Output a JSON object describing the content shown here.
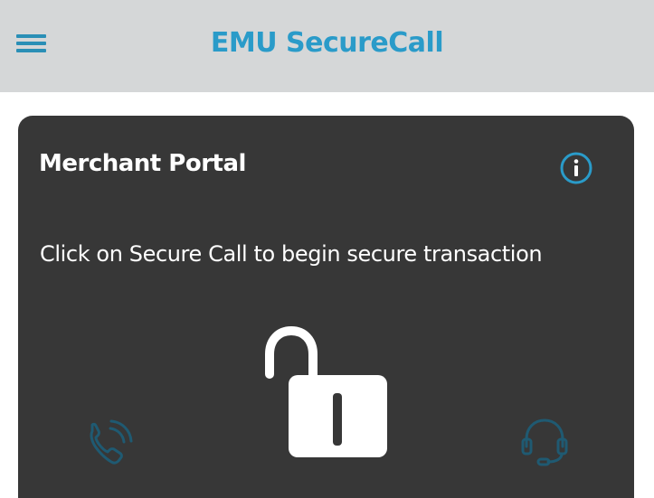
{
  "header": {
    "title": "EMU SecureCall",
    "menu_icon": "hamburger-menu-icon"
  },
  "card": {
    "title": "Merchant Portal",
    "info_icon": "info-icon",
    "instruction": "Click on Secure Call to begin secure transaction",
    "lock_icon": "unlocked-padlock-icon",
    "call_icon": "phone-call-icon",
    "support_icon": "headset-icon"
  },
  "colors": {
    "header_bg": "#d5d7d8",
    "accent": "#2a9bc9",
    "card_bg": "#373737",
    "muted_icon": "#1f5a72",
    "text_light": "#ffffff"
  }
}
